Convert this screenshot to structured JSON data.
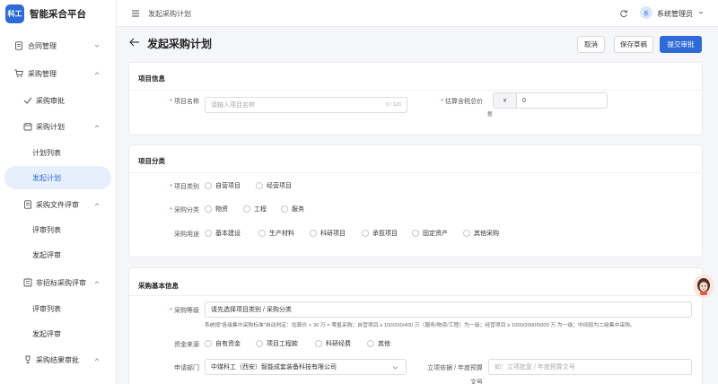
{
  "brand": {
    "logo_text": "科工",
    "title": "智能采合平台"
  },
  "sidebar": {
    "items": [
      {
        "label": "合同管理",
        "icon": "document-icon",
        "chevron": "down"
      },
      {
        "label": "采购管理",
        "icon": "cart-icon",
        "chevron": "up"
      },
      {
        "label": "采购审批",
        "icon": "check-icon"
      },
      {
        "label": "采购计划",
        "icon": "calendar-icon",
        "chevron": "up"
      },
      {
        "label": "计划列表"
      },
      {
        "label": "发起计划",
        "active": true
      },
      {
        "label": "采购文件评审",
        "icon": "document-icon",
        "chevron": "up"
      },
      {
        "label": "评审列表"
      },
      {
        "label": "发起评审"
      },
      {
        "label": "非招标采购评审",
        "icon": "list-icon",
        "chevron": "up"
      },
      {
        "label": "评审列表"
      },
      {
        "label": "发起评审"
      },
      {
        "label": "采购结果审批",
        "icon": "trophy-icon",
        "chevron": "up"
      }
    ]
  },
  "topbar": {
    "breadcrumb": "发起采购计划",
    "user_avatar": "系",
    "user_name": "系统管理员"
  },
  "page": {
    "title": "发起采购计划",
    "cancel": "取消",
    "save_draft": "保存草稿",
    "submit": "提交审批"
  },
  "project_info": {
    "title": "项目信息",
    "name_label": "项目名称",
    "name_placeholder": "请输入项目名称",
    "name_counter": "0 / 120",
    "budget_label": "估算含税总价",
    "budget_prefix": "¥",
    "budget_value": "0",
    "budget_unit": "整"
  },
  "classification": {
    "title": "项目分类",
    "type_label": "项目类别",
    "type_options": [
      "自营项目",
      "经营项目"
    ],
    "category_label": "采购分类",
    "category_options": [
      "物资",
      "工程",
      "服务"
    ],
    "purpose_label": "采购用途",
    "purpose_options": [
      "基本建设",
      "生产材料",
      "科研项目",
      "承揽项目",
      "固定资产",
      "其他采购"
    ]
  },
  "basic": {
    "title": "采购基本信息",
    "level_label": "采购等级",
    "level_value": "请先选择项目类别 / 采购分类",
    "level_note": "系统按\"各级集中采购标准\"自动判定：估算价 < 30 万 = 零星采购；自营项目 ≥ 100/200/400 万（服务/物资/工程）为一级；经营项目 ≥ 1000/2000/5000 万 为一级；中间段为二级集中采购。",
    "fund_label": "资金来源",
    "fund_options": [
      "自有资金",
      "项目工程款",
      "科研经费",
      "其他"
    ],
    "dept_label": "申请部门",
    "dept_value": "中煤科工（西安）智能成套装备科技有限公司",
    "basis_label": "立项依据 / 年度预算",
    "basis_label_2": "文号",
    "basis_placeholder": "如：立项批复 / 年度预算文号"
  },
  "colors": {
    "accent": "#2f6bd8",
    "required": "#e0443a"
  }
}
